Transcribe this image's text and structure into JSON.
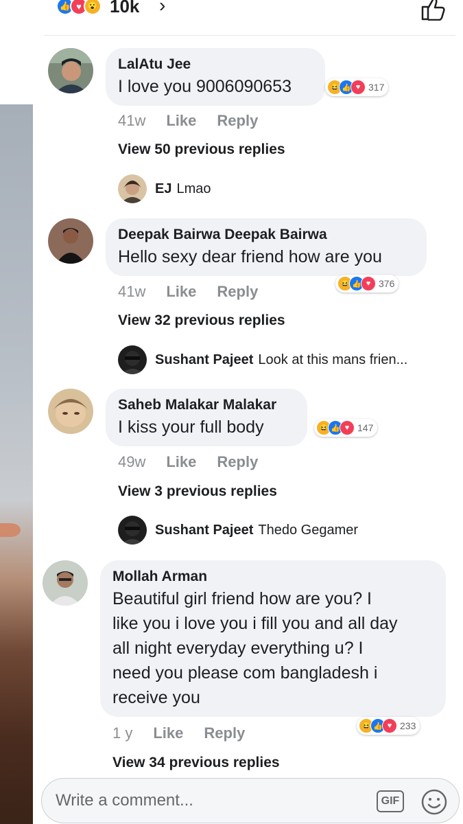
{
  "top": {
    "reactions": [
      "like",
      "love",
      "wow"
    ],
    "count": "10k",
    "chevron": "›"
  },
  "comments": [
    {
      "name": "LalAtu Jee",
      "text": "I love you 9006090653",
      "time": "41w",
      "like": "Like",
      "reply": "Reply",
      "reactions": [
        "haha",
        "like",
        "love"
      ],
      "reaction_count": "317",
      "view_prev": "View 50 previous replies",
      "last_reply": {
        "name": "EJ",
        "text": "Lmao"
      }
    },
    {
      "name": "Deepak Bairwa Deepak Bairwa",
      "text": "Hello sexy dear friend how are you",
      "time": "41w",
      "like": "Like",
      "reply": "Reply",
      "reactions": [
        "haha",
        "like",
        "love"
      ],
      "reaction_count": "376",
      "view_prev": "View 32 previous replies",
      "last_reply": {
        "name": "Sushant Pajeet",
        "text": "Look at this mans frien..."
      }
    },
    {
      "name": "Saheb Malakar Malakar",
      "text": "I kiss your full body",
      "time": "49w",
      "like": "Like",
      "reply": "Reply",
      "reactions": [
        "haha",
        "like",
        "love"
      ],
      "reaction_count": "147",
      "view_prev": "View 3 previous replies",
      "last_reply": {
        "name": "Sushant Pajeet",
        "text": "Thedo Gegamer"
      }
    },
    {
      "name": "Mollah Arman",
      "text_lines": [
        "Beautiful girl friend how are you? I",
        "like you i love you i fill you and all day",
        "all night everyday everything u? I",
        "need you please com bangladesh i",
        "receive you"
      ],
      "time": "1 y",
      "like": "Like",
      "reply": "Reply",
      "reactions": [
        "haha",
        "like",
        "love"
      ],
      "reaction_count": "233",
      "view_prev": "View 34 previous replies"
    }
  ],
  "composer": {
    "placeholder": "Write a comment...",
    "gif_label": "GIF"
  },
  "colors": {
    "like": "#1877f2",
    "love": "#f33e58",
    "haha": "#f7b125",
    "bubble": "#f0f2f5",
    "meta": "#8a8d91"
  }
}
